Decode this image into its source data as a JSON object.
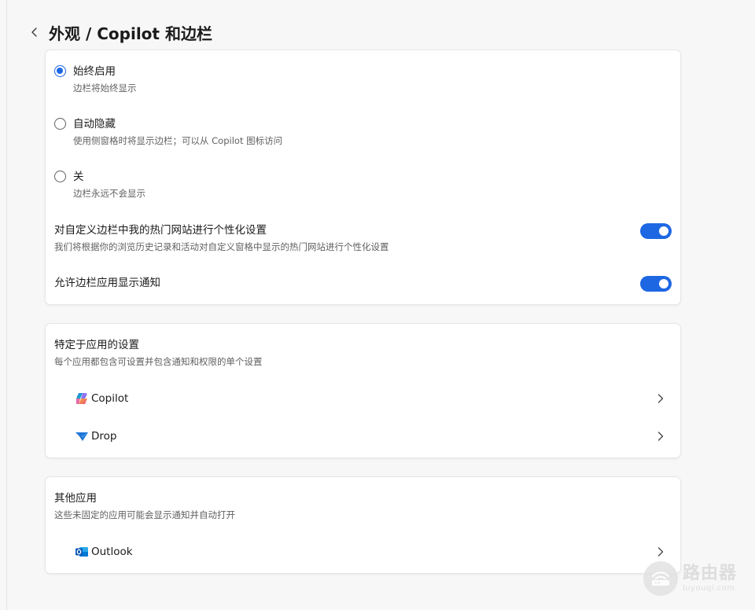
{
  "header": {
    "title": "外观 / Copilot 和边栏"
  },
  "sidebar_card": {
    "options": [
      {
        "label": "始终启用",
        "description": "边栏将始终显示",
        "selected": true
      },
      {
        "label": "自动隐藏",
        "description": "使用侧窗格时将显示边栏；可以从 Copilot 图标访问",
        "selected": false
      },
      {
        "label": "关",
        "description": "边栏永远不会显示",
        "selected": false
      }
    ],
    "toggles": [
      {
        "label": "对自定义边栏中我的热门网站进行个性化设置",
        "description": "我们将根据你的浏览历史记录和活动对自定义窗格中显示的热门网站进行个性化设置",
        "on": true
      },
      {
        "label": "允许边栏应用显示通知",
        "on": true
      }
    ]
  },
  "app_settings": {
    "title": "特定于应用的设置",
    "description": "每个应用都包含可设置并包含通知和权限的单个设置",
    "apps": [
      {
        "name": "Copilot",
        "icon": "copilot-icon"
      },
      {
        "name": "Drop",
        "icon": "drop-icon"
      }
    ]
  },
  "other_apps": {
    "title": "其他应用",
    "description": "这些未固定的应用可能会显示通知并自动打开",
    "apps": [
      {
        "name": "Outlook",
        "icon": "outlook-icon"
      }
    ]
  },
  "watermark": {
    "main": "路由器",
    "sub": "luyouqi.com"
  },
  "colors": {
    "accent": "#1e67e3",
    "card_bg": "#ffffff",
    "page_bg": "#f7f7f7"
  }
}
